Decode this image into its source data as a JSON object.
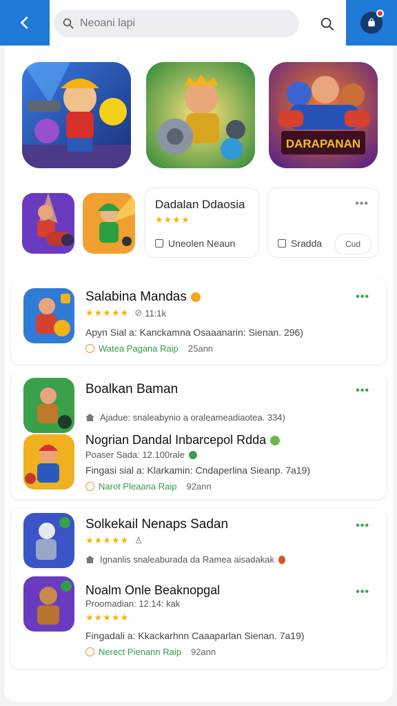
{
  "search": {
    "placeholder": "Neoani lapi"
  },
  "colors": {
    "accent": "#1e7ad6",
    "star": "#f5b400",
    "green": "#2e9e43"
  },
  "icons": [
    "back-arrow-icon",
    "search-icon",
    "profile-icon",
    "more-dots-icon",
    "clock-icon",
    "home-icon"
  ],
  "featured": [
    {
      "logo_text": ""
    },
    {
      "logo_text": ""
    },
    {
      "logo_text": "DARAPANAN"
    }
  ],
  "mini_cards": [
    {
      "title": "Dadalan Ddaosia",
      "stars": "★★★★",
      "option": "Uneolen Neaun"
    },
    {
      "title": "",
      "option": "Sradda",
      "pill": "Cud"
    }
  ],
  "list": [
    {
      "name": "Salabina Mandas",
      "stars": "★★★★★",
      "rating_meta": "11:1k",
      "desc": "Apyn Sial a: Kanckamna Osaaanarin: Sienan. 296)",
      "cta_green": "Watea Pagana Raip",
      "cta_size": "25ann"
    },
    {
      "name": "Boalkan Baman",
      "meta": "Ajadue:   snaleabynio a oraleameadiaotea. 334)",
      "sub_name": "Nogrian Dandal Inbarcepol Rdda",
      "sub_meta": "Poaser Sada: 12.100rale",
      "desc": "Fingasi sial a: Klarkamin: Cndaperlina Sieanp. 7a19)",
      "cta_green": "Narot Pleaana Raip",
      "cta_size": "92ann"
    },
    {
      "name": "Solkekail Nenaps Sadan",
      "stars": "★★★★★",
      "meta": "Ignanlis    snaleaburada da Ramea aisadakak",
      "sub_name": "Noalm Onle Beaknopgal",
      "sub_meta": "Proomadian: 12.14: kak",
      "sub_stars": "★★★★★",
      "desc": "Fingadali a: Kkackarhnn Caaaparlan Sienan. 7a19)",
      "cta_green": "Nerect Pienann Raip",
      "cta_size": "92ann"
    }
  ]
}
